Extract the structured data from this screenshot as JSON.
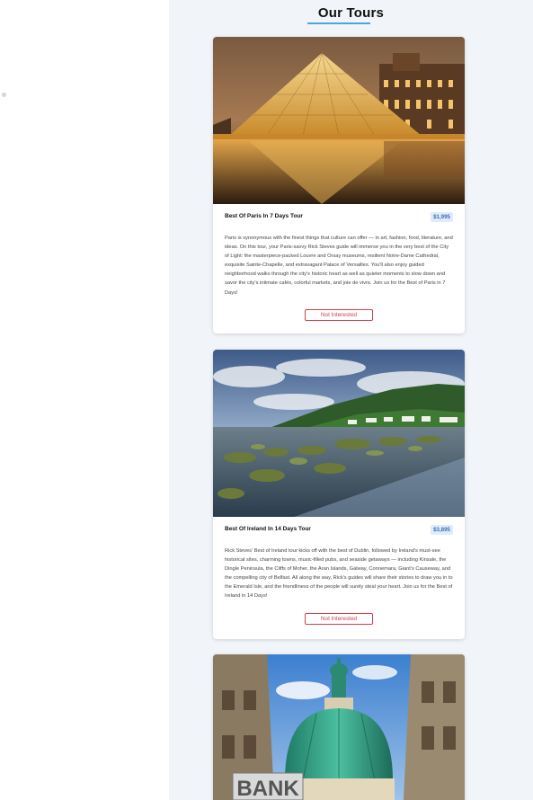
{
  "header": {
    "title": "Our Tours"
  },
  "tours": [
    {
      "title": "Best Of Paris In 7 Days Tour",
      "price": "$1,995",
      "image": "louvre-pyramid-night",
      "description": "Paris is synonymous with the finest things that culture can offer — in art, fashion, food, literature, and ideas. On this tour, your Paris-savvy Rick Steves guide will immerse you in the very best of the City of Light: the masterpiece-packed Louvre and Orsay museums, resilient Notre-Dame Cathedral, exquisite Sainte-Chapelle, and extravagant Palace of Versailles. You'll also enjoy guided neighborhood walks through the city's historic heart as well as quieter moments to slow down and savor the city's intimate cafés, colorful markets, and joie de vivre. Join us for the Best of Paris in 7 Days!",
      "button_label": "Not Interested"
    },
    {
      "title": "Best Of Ireland In 14 Days Tour",
      "price": "$3,895",
      "image": "irish-coast-mossy-rocks",
      "description": "Rick Steves' Best of Ireland tour kicks off with the best of Dublin, followed by Ireland's must-see historical sites, charming towns, music-filled pubs, and seaside getaways — including Kinsale, the Dingle Peninsula, the Cliffs of Moher, the Aran Islands, Galway, Connemara, Giant's Causeway, and the compelling city of Belfast. All along the way, Rick's guides will share their stories to draw you in to the Emerald Isle, and the friendliness of the people will surely steal your heart. Join us for the Best of Ireland in 14 Days!",
      "button_label": "Not Interested"
    },
    {
      "image": "vienna-green-dome-bank-sign",
      "image_text": "BANK"
    }
  ],
  "colors": {
    "accent": "#4aa8d8",
    "price_bg": "#e0ecfb",
    "price_text": "#3a70b8",
    "danger": "#d0404a",
    "main_bg": "#f1f4f8"
  }
}
